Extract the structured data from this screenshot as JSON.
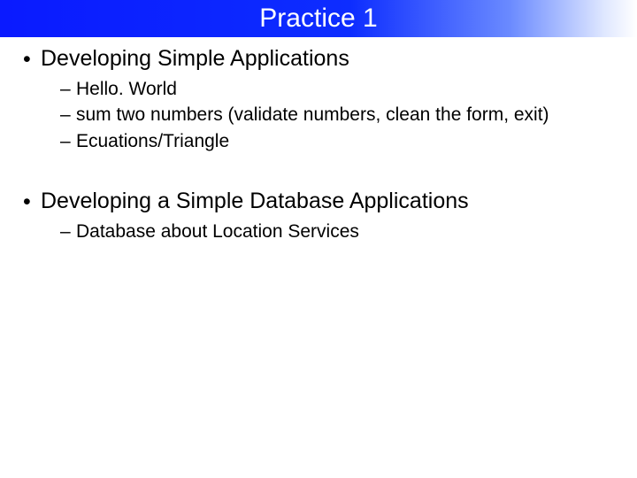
{
  "title": "Practice 1",
  "sections": [
    {
      "heading": "Developing Simple Applications",
      "items": [
        "Hello. World",
        "sum two numbers (validate numbers, clean the form, exit)",
        "Ecuations/Triangle"
      ]
    },
    {
      "heading": "Developing a Simple Database Applications",
      "items": [
        "Database about Location Services"
      ]
    }
  ]
}
